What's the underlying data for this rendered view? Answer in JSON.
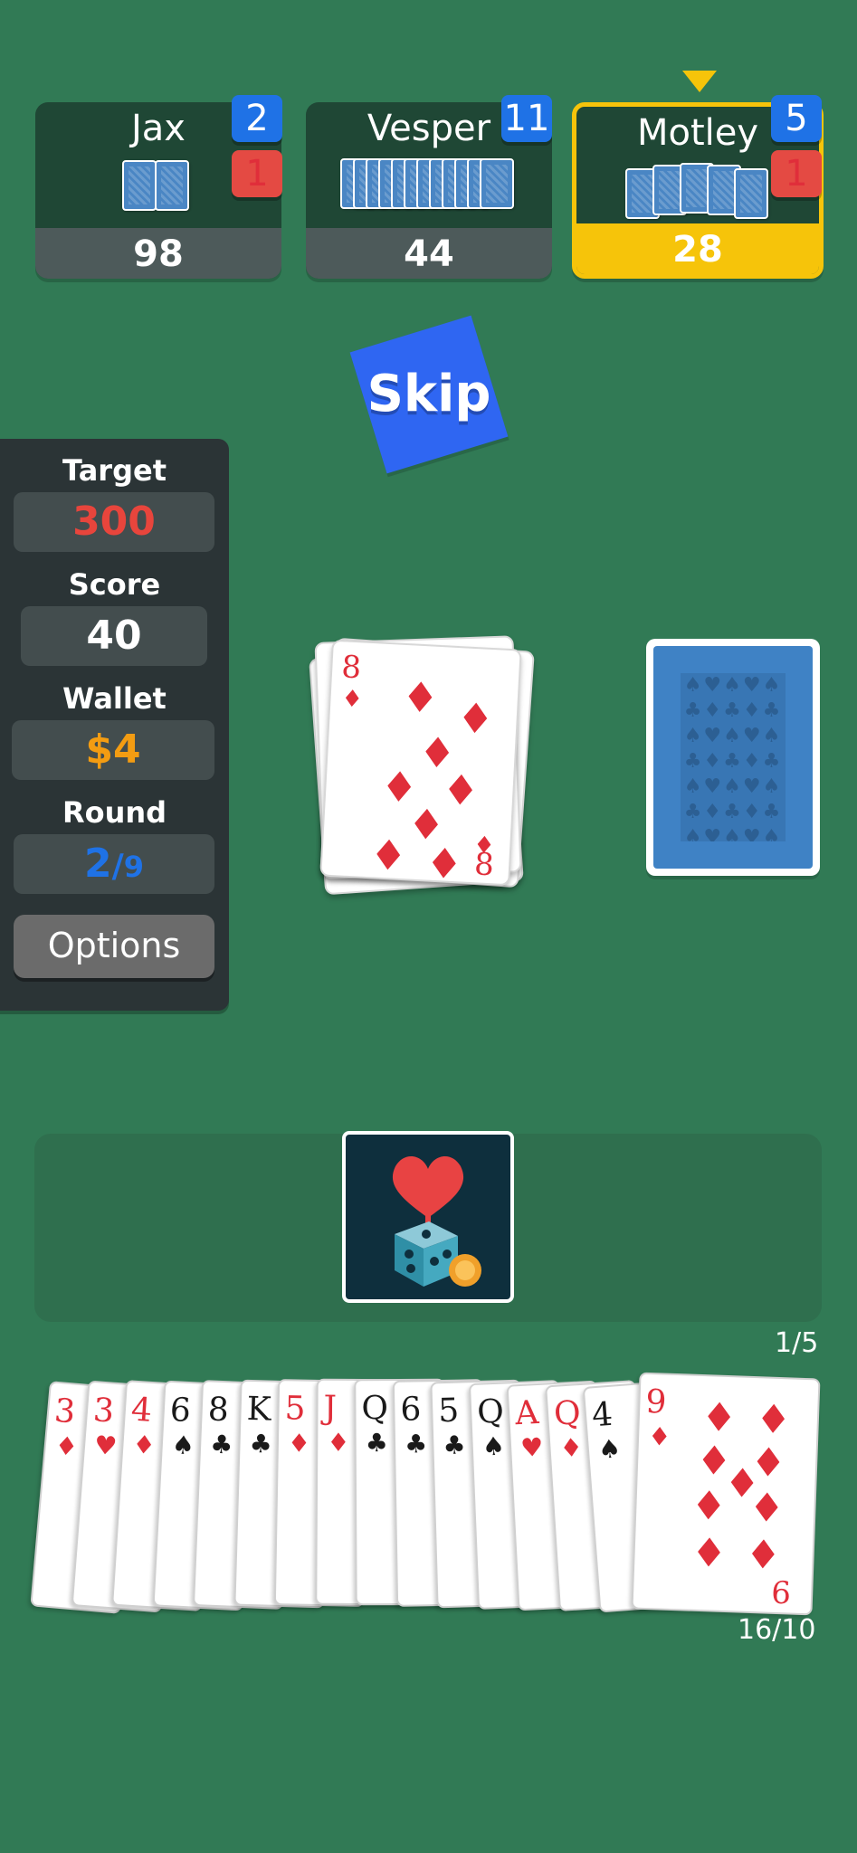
{
  "opponents": [
    {
      "name": "Jax",
      "score": "98",
      "badge_blue": "2",
      "badge_red": "1",
      "active": false
    },
    {
      "name": "Vesper",
      "score": "44",
      "badge_blue": "11",
      "active": false
    },
    {
      "name": "Motley",
      "score": "28",
      "badge_blue": "5",
      "badge_red": "1",
      "active": true
    }
  ],
  "action": {
    "label": "Skip"
  },
  "info": {
    "target_label": "Target",
    "target_value": "300",
    "score_label": "Score",
    "score_value": "40",
    "wallet_label": "Wallet",
    "wallet_value": "$4",
    "round_label": "Round",
    "round_current": "2",
    "round_sep": "/",
    "round_total": "9",
    "options_label": "Options"
  },
  "discard": {
    "rank": "8",
    "suit": "♦"
  },
  "joker_counter": "1/5",
  "hand_counter": "16/10",
  "hand": [
    {
      "rank": "3",
      "suit": "♦",
      "color": "red"
    },
    {
      "rank": "3",
      "suit": "♥",
      "color": "red"
    },
    {
      "rank": "4",
      "suit": "♦",
      "color": "red"
    },
    {
      "rank": "6",
      "suit": "♠",
      "color": "blk"
    },
    {
      "rank": "8",
      "suit": "♣",
      "color": "blk"
    },
    {
      "rank": "K",
      "suit": "♣",
      "color": "blk"
    },
    {
      "rank": "5",
      "suit": "♦",
      "color": "red"
    },
    {
      "rank": "J",
      "suit": "♦",
      "color": "red"
    },
    {
      "rank": "Q",
      "suit": "♣",
      "color": "blk"
    },
    {
      "rank": "6",
      "suit": "♣",
      "color": "blk"
    },
    {
      "rank": "5",
      "suit": "♣",
      "color": "blk"
    },
    {
      "rank": "Q",
      "suit": "♠",
      "color": "blk"
    },
    {
      "rank": "A",
      "suit": "♥",
      "color": "red"
    },
    {
      "rank": "Q",
      "suit": "♦",
      "color": "red"
    },
    {
      "rank": "4",
      "suit": "♠",
      "color": "blk"
    },
    {
      "rank": "9",
      "suit": "♦",
      "color": "red"
    }
  ],
  "colors": {
    "table": "#317a55",
    "accent_yellow": "#f6c40a",
    "badge_blue": "#1f72e6",
    "badge_red": "#e44a43",
    "target_red": "#e8453c",
    "wallet_orange": "#f39c12",
    "round_blue": "#1f72e6"
  }
}
